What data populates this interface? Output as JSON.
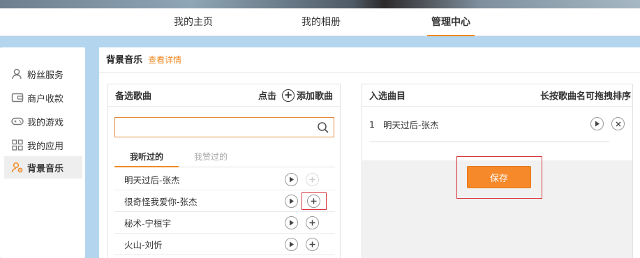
{
  "nav": {
    "items": [
      {
        "label": "我的主页"
      },
      {
        "label": "我的相册"
      },
      {
        "label": "管理中心"
      }
    ],
    "active_index": 2
  },
  "sidebar": {
    "items": [
      {
        "label": "粉丝服务",
        "icon": "user-icon"
      },
      {
        "label": "商户收款",
        "icon": "wallet-icon"
      },
      {
        "label": "我的游戏",
        "icon": "gamepad-icon"
      },
      {
        "label": "我的应用",
        "icon": "apps-grid-icon"
      },
      {
        "label": "背景音乐",
        "icon": "user-gear-icon",
        "active": true
      }
    ]
  },
  "main": {
    "title": "背景音乐",
    "details_link": "查看详情"
  },
  "candidates": {
    "title": "备选歌曲",
    "click_label": "点击",
    "add_label": "添加歌曲",
    "search": {
      "value": "",
      "placeholder": ""
    },
    "tabs": [
      {
        "label": "我听过的",
        "active": true
      },
      {
        "label": "我赞过的",
        "active": false
      }
    ],
    "songs": [
      {
        "name": "明天过后-张杰",
        "added": true
      },
      {
        "name": "很奇怪我爱你-张杰",
        "added": false
      },
      {
        "name": "秘术-宁桓宇",
        "added": false
      },
      {
        "name": "火山-刘忻",
        "added": false
      }
    ]
  },
  "selected": {
    "title": "入选曲目",
    "hint": "长按歌曲名可拖拽排序",
    "songs": [
      {
        "index": "1",
        "name": "明天过后-张杰"
      }
    ],
    "save_label": "保存"
  },
  "colors": {
    "accent": "#f08a24",
    "save_button": "#f6892a",
    "highlight_outline": "#d9363e",
    "background": "#b3d6ee"
  }
}
